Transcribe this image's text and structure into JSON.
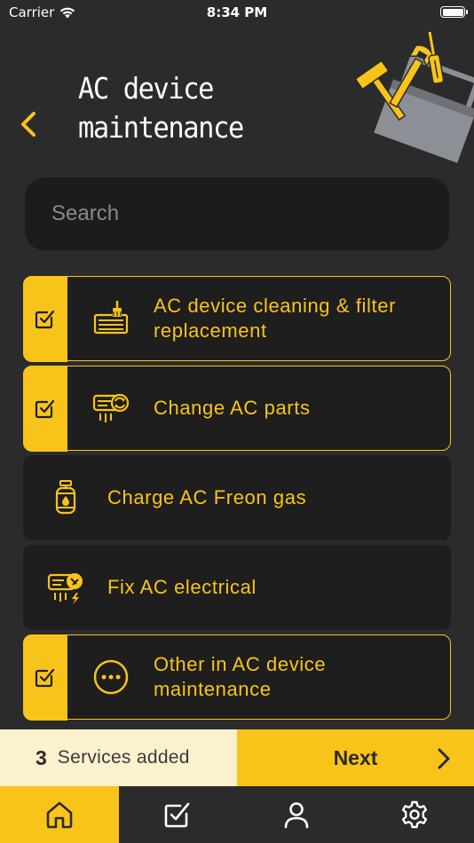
{
  "status_bar": {
    "carrier": "Carrier",
    "time": "8:34 PM"
  },
  "header": {
    "title": "AC device maintenance",
    "back_icon": "chevron-left-icon",
    "illustration": "toolbox-illustration"
  },
  "search": {
    "placeholder": "Search",
    "value": ""
  },
  "services": [
    {
      "label": "AC device cleaning & filter replacement",
      "icon": "ac-cleaning-icon",
      "selected": true
    },
    {
      "label": "Change AC parts",
      "icon": "ac-parts-icon",
      "selected": true
    },
    {
      "label": "Charge AC Freon gas",
      "icon": "gas-cylinder-icon",
      "selected": false
    },
    {
      "label": "Fix AC electrical",
      "icon": "ac-electrical-icon",
      "selected": false
    },
    {
      "label": "Other in AC device maintenance",
      "icon": "more-dots-icon",
      "selected": true
    }
  ],
  "summary": {
    "count": "3",
    "text": "Services added",
    "next_label": "Next"
  },
  "tabs": [
    {
      "name": "home",
      "icon": "home-icon",
      "active": true
    },
    {
      "name": "orders",
      "icon": "checklist-icon",
      "active": false
    },
    {
      "name": "profile",
      "icon": "user-icon",
      "active": false
    },
    {
      "name": "settings",
      "icon": "gear-icon",
      "active": false
    }
  ],
  "colors": {
    "background": "#2b2b2b",
    "card": "#1e1e1e",
    "accent": "#f9c41a",
    "summary_bg": "#fcf1cf"
  }
}
